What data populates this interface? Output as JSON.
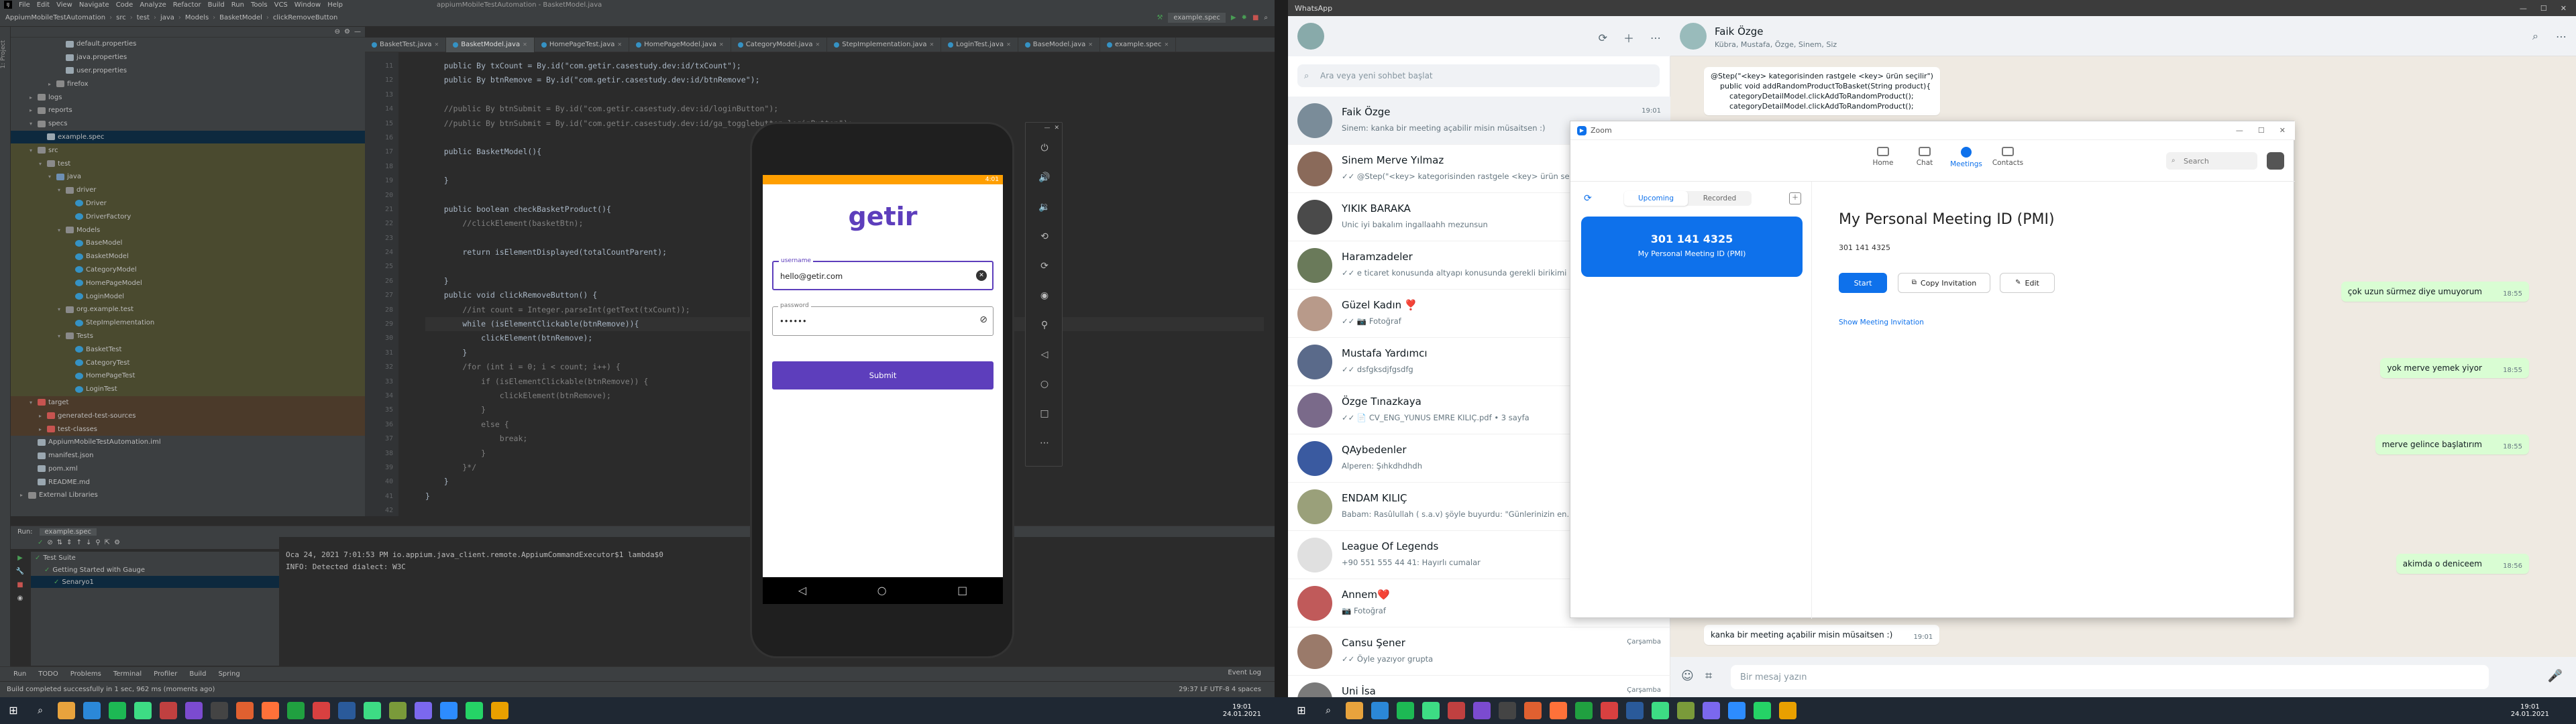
{
  "intellij": {
    "menu": [
      "File",
      "Edit",
      "View",
      "Navigate",
      "Code",
      "Analyze",
      "Refactor",
      "Build",
      "Run",
      "Tools",
      "VCS",
      "Window",
      "Help"
    ],
    "window_title": "appiumMobileTestAutomation - BasketModel.java",
    "breadcrumbs": [
      "AppiumMobileTestAutomation",
      "src",
      "test",
      "java",
      "Models",
      "BasketModel",
      "clickRemoveButton"
    ],
    "run_config": "example.spec",
    "tabs": [
      "BasketTest.java",
      "BasketModel.java",
      "HomePageTest.java",
      "HomePageModel.java",
      "CategoryModel.java",
      "StepImplementation.java",
      "LoginTest.java",
      "BaseModel.java",
      "example.spec"
    ],
    "active_tab_index": 1,
    "sidebar_label": "1: Project",
    "tree": [
      {
        "label": "default.properties",
        "indent": 5,
        "icon": "file"
      },
      {
        "label": "java.properties",
        "indent": 5,
        "icon": "file"
      },
      {
        "label": "user.properties",
        "indent": 5,
        "icon": "file"
      },
      {
        "label": "firefox",
        "indent": 4,
        "icon": "folder",
        "arrow": "▸"
      },
      {
        "label": "logs",
        "indent": 2,
        "icon": "folder",
        "arrow": "▸"
      },
      {
        "label": "reports",
        "indent": 2,
        "icon": "folder",
        "arrow": "▸"
      },
      {
        "label": "specs",
        "indent": 2,
        "icon": "folder",
        "arrow": "▾"
      },
      {
        "label": "example.spec",
        "indent": 3,
        "icon": "file",
        "sel": true
      },
      {
        "label": "src",
        "indent": 2,
        "icon": "folder",
        "arrow": "▾",
        "bg": "olive"
      },
      {
        "label": "test",
        "indent": 3,
        "icon": "folder",
        "arrow": "▾",
        "bg": "olive"
      },
      {
        "label": "java",
        "indent": 4,
        "icon": "jfolder",
        "arrow": "▾",
        "bg": "olive"
      },
      {
        "label": "driver",
        "indent": 5,
        "icon": "folder",
        "arrow": "▾",
        "bg": "olive"
      },
      {
        "label": "Driver",
        "indent": 6,
        "icon": "class",
        "bg": "olive"
      },
      {
        "label": "DriverFactory",
        "indent": 6,
        "icon": "class",
        "bg": "olive"
      },
      {
        "label": "Models",
        "indent": 5,
        "icon": "folder",
        "arrow": "▾",
        "bg": "olive"
      },
      {
        "label": "BaseModel",
        "indent": 6,
        "icon": "class",
        "bg": "olive"
      },
      {
        "label": "BasketModel",
        "indent": 6,
        "icon": "class",
        "bg": "olive"
      },
      {
        "label": "CategoryModel",
        "indent": 6,
        "icon": "class",
        "bg": "olive"
      },
      {
        "label": "HomePageModel",
        "indent": 6,
        "icon": "class",
        "bg": "olive"
      },
      {
        "label": "LoginModel",
        "indent": 6,
        "icon": "class",
        "bg": "olive"
      },
      {
        "label": "org.example.test",
        "indent": 5,
        "icon": "folder",
        "arrow": "▾",
        "bg": "olive"
      },
      {
        "label": "StepImplementation",
        "indent": 6,
        "icon": "class",
        "bg": "olive"
      },
      {
        "label": "Tests",
        "indent": 5,
        "icon": "folder",
        "arrow": "▾",
        "bg": "olive"
      },
      {
        "label": "BasketTest",
        "indent": 6,
        "icon": "class",
        "bg": "olive"
      },
      {
        "label": "CategoryTest",
        "indent": 6,
        "icon": "class",
        "bg": "olive"
      },
      {
        "label": "HomePageTest",
        "indent": 6,
        "icon": "class",
        "bg": "olive"
      },
      {
        "label": "LoginTest",
        "indent": 6,
        "icon": "class",
        "bg": "olive"
      },
      {
        "label": "target",
        "indent": 2,
        "icon": "red",
        "arrow": "▾",
        "bg": "brown"
      },
      {
        "label": "generated-test-sources",
        "indent": 3,
        "icon": "red",
        "arrow": "▸",
        "bg": "brown"
      },
      {
        "label": "test-classes",
        "indent": 3,
        "icon": "red",
        "arrow": "▸",
        "bg": "brown"
      },
      {
        "label": "AppiumMobileTestAutomation.iml",
        "indent": 2,
        "icon": "file"
      },
      {
        "label": "manifest.json",
        "indent": 2,
        "icon": "file"
      },
      {
        "label": "pom.xml",
        "indent": 2,
        "icon": "file"
      },
      {
        "label": "README.md",
        "indent": 2,
        "icon": "file"
      },
      {
        "label": "External Libraries",
        "indent": 1,
        "icon": "folder",
        "arrow": "▸"
      }
    ],
    "gutter_start": 11,
    "code_lines": [
      "    public By txCount = By.id(\"com.getir.casestudy.dev:id/txCount\");",
      "    public By btnRemove = By.id(\"com.getir.casestudy.dev:id/btnRemove\");",
      "",
      "    //public By btnSubmit = By.id(\"com.getir.casestudy.dev:id/loginButton\");",
      "    //public By btnSubmit = By.id(\"com.getir.casestudy.dev:id/ga_togglebutton_loginButton\");",
      "",
      "    public BasketModel(){",
      "",
      "    }",
      "",
      "    public boolean checkBasketProduct(){",
      "        //clickElement(basketBtn);",
      "",
      "        return isElementDisplayed(totalCountParent);",
      "",
      "    }",
      "    public void clickRemoveButton() {",
      "        //int count = Integer.parseInt(getText(txCount));",
      "        while (isElementClickable(btnRemove)){",
      "            clickElement(btnRemove);",
      "        }",
      "        /for (int i = 0; i < count; i++) {",
      "            if (isElementClickable(btnRemove)) {",
      "                clickElement(btnRemove);",
      "            }",
      "            else {",
      "                break;",
      "            }",
      "        }*/",
      "    }",
      "}",
      ""
    ],
    "run_tab": "Run:",
    "run_config_tab": "example.spec",
    "run_tree": [
      {
        "label": "Test Suite",
        "indent": 0
      },
      {
        "label": "Getting Started with Gauge",
        "indent": 1
      },
      {
        "label": "Senaryo1",
        "indent": 2,
        "sel": true
      }
    ],
    "console_lines": [
      "Oca 24, 2021 7:01:53 PM io.appium.java_client.remote.AppiumCommandExecutor$1 lambda$0",
      "INFO: Detected dialect: W3C"
    ],
    "toolstrip": [
      "Run",
      "TODO",
      "Problems",
      "Terminal",
      "Profiler",
      "Build",
      "Spring"
    ],
    "event_log": "Event Log",
    "status": "Build completed successfully in 1 sec, 962 ms (moments ago)",
    "status_right": "29:37  LF  UTF-8  4 spaces"
  },
  "phone": {
    "status_time": "4:01",
    "logo": "getir",
    "username_label": "username",
    "username_value": "hello@getir.com",
    "password_label": "password",
    "password_value": "••••••",
    "submit_label": "Submit"
  },
  "whatsapp": {
    "title": "WhatsApp",
    "search_placeholder": "Ara veya yeni sohbet başlat",
    "chats": [
      {
        "name": "Faik Özge",
        "preview": "Sinem: kanka bir meeting açabilir misin müsaitsen :)",
        "time": "19:01",
        "sel": true
      },
      {
        "name": "Sinem Merve Yılmaz",
        "preview": "✓✓ @Step(\"<key> kategorisinden rastgele <key> ürün se...",
        "time": ""
      },
      {
        "name": "YIKIK BARAKA",
        "preview": "Unic iyi bakalım ingallaahh mezunsun",
        "time": ""
      },
      {
        "name": "Haramzadeler",
        "preview": "✓✓ e ticaret konusunda altyapı konusunda gerekli birikimi",
        "time": ""
      },
      {
        "name": "Güzel Kadın ❣️",
        "preview": "✓✓ 📷 Fotoğraf",
        "time": ""
      },
      {
        "name": "Mustafa Yardımcı",
        "preview": "✓✓ dsfgksdjfgsdfg",
        "time": ""
      },
      {
        "name": "Özge Tınazkaya",
        "preview": "✓✓ 📄 CV_ENG_YUNUS EMRE KILIÇ.pdf • 3 sayfa",
        "time": ""
      },
      {
        "name": "QAybedenler",
        "preview": "Alperen: Şıhkdhdhdh",
        "time": ""
      },
      {
        "name": "ENDAM KILIÇ",
        "preview": "Babam: Rasûlullah ( s.a.v) şöyle buyurdu: \"Günlerinizin en...",
        "time": ""
      },
      {
        "name": "League Of Legends",
        "preview": "+90 551 555 44 41: Hayırlı cumalar",
        "time": ""
      },
      {
        "name": "Annem❤️",
        "preview": "📷 Fotoğraf",
        "time": ""
      },
      {
        "name": "Cansu Şener",
        "preview": "✓✓ Öyle yazıyor grupta",
        "time": "Çarşamba"
      },
      {
        "name": "Uni İsa",
        "preview": "",
        "time": "Çarşamba"
      }
    ],
    "header_name": "Faik Özge",
    "header_members": "Kübra, Mustafa, Özge, Sinem, Siz",
    "code_bubble": [
      "@Step(\"<key> kategorisinden rastgele <key> ürün seçilir\")",
      "    public void addRandomProductToBasket(String product){",
      "        categoryDetailModel.clickAddToRandomProduct();",
      "        categoryDetailModel.clickAddToRandomProduct();"
    ],
    "bubbles": [
      {
        "text": "çok uzun sürmez diye umuyorum",
        "time": "18:55"
      },
      {
        "text": "yok merve yemek yiyor",
        "time": "18:55"
      },
      {
        "text": "merve gelince başlatırım",
        "time": "18:55"
      },
      {
        "text": "akimda o deniceem",
        "time": "18:56"
      }
    ],
    "last_in_bubble": "kanka bir meeting açabilir misin müsaitsen :)",
    "last_in_time": "19:01",
    "input_placeholder": "Bir mesaj yazın"
  },
  "zoom": {
    "title": "Zoom",
    "nav": [
      "Home",
      "Chat",
      "Meetings",
      "Contacts"
    ],
    "active_nav": 2,
    "search_placeholder": "Search",
    "segments": [
      "Upcoming",
      "Recorded"
    ],
    "card_id": "301 141 4325",
    "card_label": "My Personal Meeting ID (PMI)",
    "main_title": "My Personal Meeting ID (PMI)",
    "main_id": "301 141 4325",
    "start_label": "Start",
    "copy_label": "Copy Invitation",
    "edit_label": "Edit",
    "show_invitation": "Show Meeting Invitation"
  },
  "taskbar": {
    "left_time": "19:01",
    "left_date": "24.01.2021",
    "right_time": "19:01",
    "right_date": "24.01.2021"
  },
  "colors": {
    "getir_purple": "#5d3ebc",
    "zoom_blue": "#0e71eb",
    "wa_green": "#d9fdd3"
  }
}
